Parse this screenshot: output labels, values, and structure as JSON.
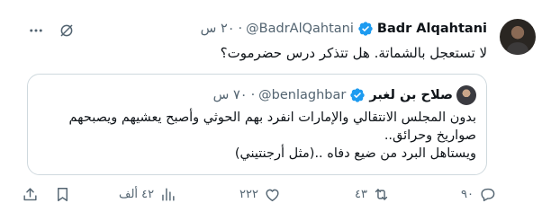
{
  "tweet": {
    "author_name": "Badr Alqahtani",
    "handle": "@BadrAlQahtani",
    "separator": "·",
    "time": "٢٠ س",
    "text": "لا تستعجل بالشماتة. هل تتذكر درس حضرموت؟",
    "icons": [
      "more-icon",
      "grok-icon",
      "verified-icon"
    ]
  },
  "quoted": {
    "author_name": "صلاح بن لغبر",
    "handle": "@benlaghbar",
    "separator": "·",
    "time": "٧٠ س",
    "lines": [
      "بدون المجلس الانتقالي والإمارات انفرد بهم الحوثي وأصبح يعشيهم ويصبحهم",
      "صواريخ وحرائق..",
      "ويستاهل البرد من ضيع دفاه ..(مثل أرجنتيني)"
    ]
  },
  "actions": {
    "replies": "٩٠",
    "retweets": "٤٣",
    "likes": "٢٢٢",
    "views": "٤٢ ألف",
    "icons": [
      "reply-icon",
      "retweet-icon",
      "like-icon",
      "views-icon",
      "bookmark-icon",
      "share-icon"
    ]
  },
  "colors": {
    "verified": "#1d9bf0",
    "secondary_text": "#536471",
    "border": "#cfd9de"
  }
}
